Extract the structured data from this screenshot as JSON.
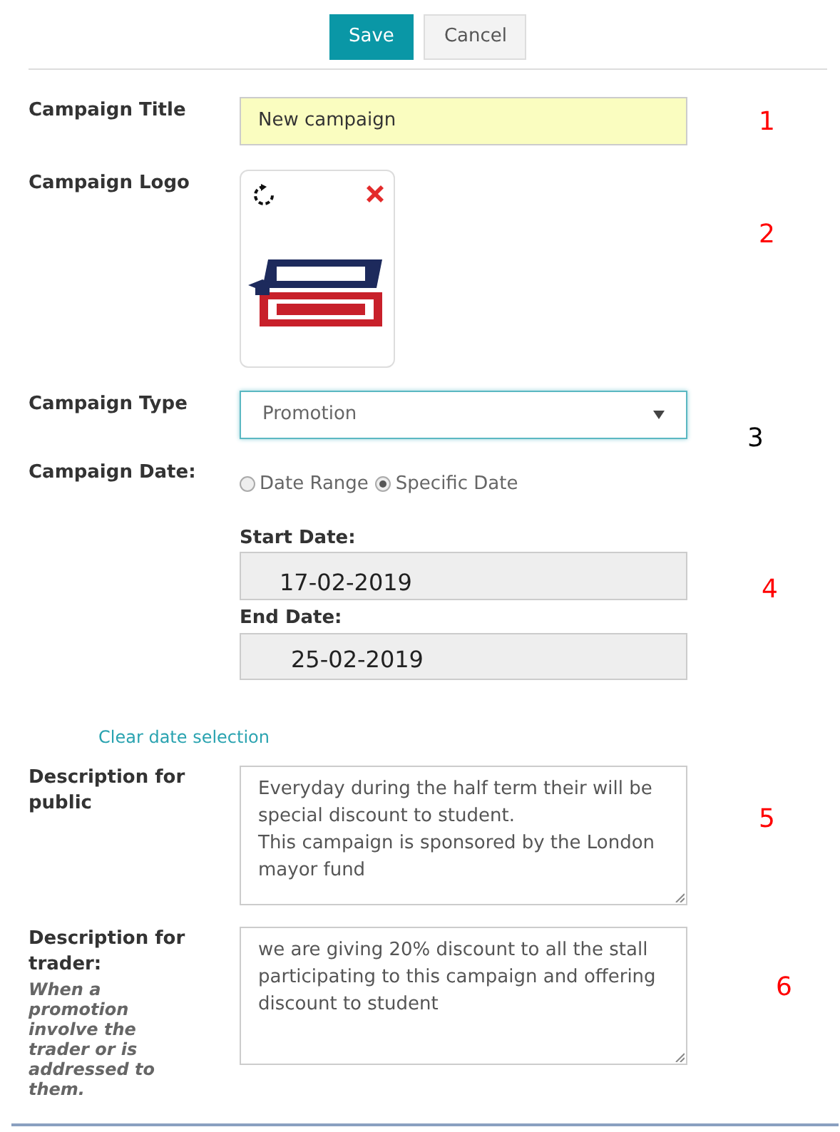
{
  "toolbar": {
    "buttons": [
      {
        "label": "Save",
        "kind": "primary"
      },
      {
        "label": "Cancel",
        "kind": "secondary"
      }
    ]
  },
  "form": {
    "title": {
      "label": "Campaign Title",
      "value": "New campaign"
    },
    "logo": {
      "label": "Campaign Logo"
    },
    "type": {
      "label": "Campaign Type",
      "value": "Promotion"
    },
    "date": {
      "label": "Campaign Date:",
      "options": [
        {
          "label": "Date Range",
          "selected": false
        },
        {
          "label": "Specific Date",
          "selected": true
        }
      ],
      "start": {
        "label": "Start Date:",
        "value": "17-02-2019"
      },
      "end": {
        "label": "End Date:",
        "value": "25-02-2019"
      },
      "clear_link": "Clear date selection"
    },
    "public_description": {
      "label": "Description for public",
      "value": "Everyday during the half term their will be special discount to student.\nThis campaign is sponsored by the London mayor fund"
    },
    "trader_description": {
      "label": "Description for trader:",
      "hint": "When a promotion involve the trader or is addressed to them.",
      "value": "we are giving 20% discount to all the stall participating to this campaign and offering discount to student"
    }
  },
  "annotations": [
    {
      "text": "1",
      "color": "#ff0000"
    },
    {
      "text": "2",
      "color": "#ff0000"
    },
    {
      "text": "3",
      "color": "#000000"
    },
    {
      "text": "4",
      "color": "#ff0000"
    },
    {
      "text": "5",
      "color": "#ff0000"
    },
    {
      "text": "6",
      "color": "#ff0000"
    }
  ]
}
